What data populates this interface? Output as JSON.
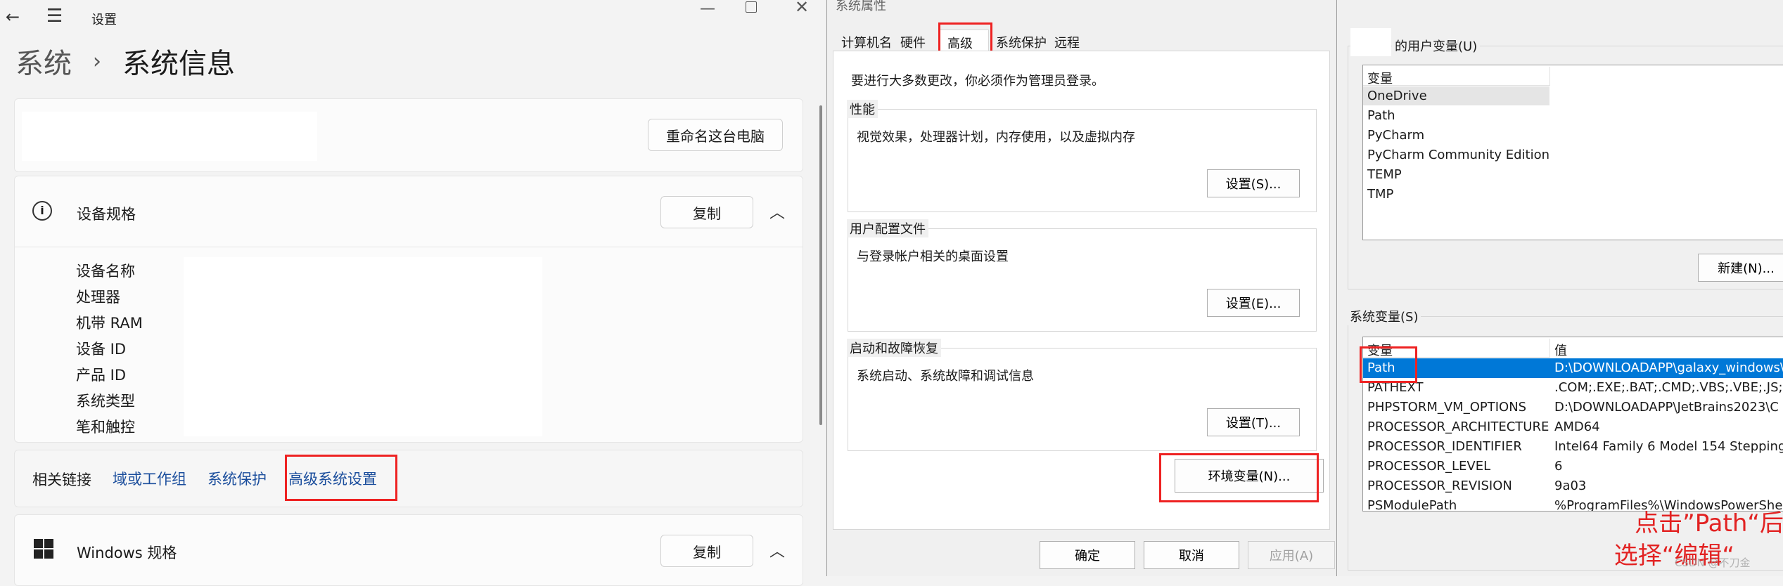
{
  "settings": {
    "app_title": "设置",
    "breadcrumb_parent": "系统",
    "breadcrumb_sep": "›",
    "breadcrumb_current": "系统信息",
    "rename_button": "重命名这台电脑",
    "device_spec_title": "设备规格",
    "copy_label": "复制",
    "spec_labels": [
      "设备名称",
      "处理器",
      "机带 RAM",
      "设备 ID",
      "产品 ID",
      "系统类型",
      "笔和触控"
    ],
    "related_label": "相关链接",
    "links": [
      "域或工作组",
      "系统保护",
      "高级系统设置"
    ],
    "windows_spec_title": "Windows 规格"
  },
  "sysprops": {
    "title": "系统属性",
    "tabs": [
      "计算机名",
      "硬件",
      "高级",
      "系统保护",
      "远程"
    ],
    "admin_note": "要进行大多数更改，你必须作为管理员登录。",
    "perf_title": "性能",
    "perf_desc": "视觉效果，处理器计划，内存使用，以及虚拟内存",
    "perf_button": "设置(S)...",
    "profile_title": "用户配置文件",
    "profile_desc": "与登录帐户相关的桌面设置",
    "profile_button": "设置(E)...",
    "startup_title": "启动和故障恢复",
    "startup_desc": "系统启动、系统故障和调试信息",
    "startup_button": "设置(T)...",
    "env_button": "环境变量(N)...",
    "ok": "确定",
    "cancel": "取消",
    "apply": "应用(A)"
  },
  "envvars": {
    "user_group_title": "的用户变量(U)",
    "var_header": "变量",
    "value_header": "值",
    "user_vars": [
      "OneDrive",
      "Path",
      "PyCharm",
      "PyCharm Community Edition",
      "TEMP",
      "TMP"
    ],
    "new_button": "新建(N)...",
    "sys_group_title": "系统变量(S)",
    "sys_vars": [
      {
        "name": "Path",
        "value": "D:\\DOWNLOADAPP\\galaxy_windows\\"
      },
      {
        "name": "PATHEXT",
        "value": ".COM;.EXE;.BAT;.CMD;.VBS;.VBE;.JS;.JSE"
      },
      {
        "name": "PHPSTORM_VM_OPTIONS",
        "value": "D:\\DOWNLOADAPP\\JetBrains2023\\C"
      },
      {
        "name": "PROCESSOR_ARCHITECTURE",
        "value": "AMD64"
      },
      {
        "name": "PROCESSOR_IDENTIFIER",
        "value": "Intel64 Family 6 Model 154 Stepping"
      },
      {
        "name": "PROCESSOR_LEVEL",
        "value": "6"
      },
      {
        "name": "PROCESSOR_REVISION",
        "value": "9a03"
      },
      {
        "name": "PSModulePath",
        "value": "%ProgramFiles%\\WindowsPowerShell"
      }
    ],
    "annotation_line1": "点击”Path“后",
    "annotation_line2": "选择“编辑“",
    "watermark": "CSDN @不刀金"
  },
  "colors": {
    "accent": "#0078d7",
    "annotation_red": "#e22222",
    "link_blue": "#1a4d9c"
  }
}
